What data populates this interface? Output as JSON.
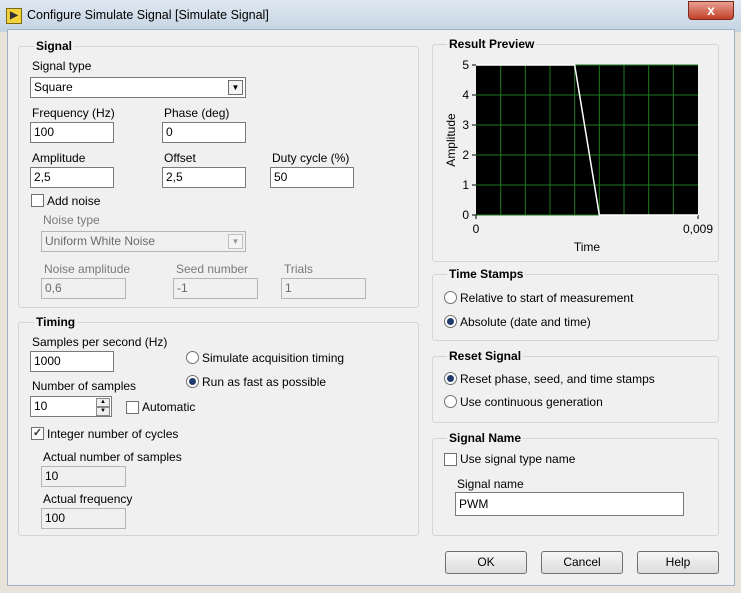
{
  "window": {
    "title": "Configure Simulate Signal [Simulate Signal]",
    "icon_name": "labview-vi-icon",
    "close_glyph": "x"
  },
  "signal": {
    "group_title": "Signal",
    "signal_type_label": "Signal type",
    "signal_type_value": "Square",
    "frequency_label": "Frequency (Hz)",
    "frequency_value": "100",
    "phase_label": "Phase (deg)",
    "phase_value": "0",
    "amplitude_label": "Amplitude",
    "amplitude_value": "2,5",
    "offset_label": "Offset",
    "offset_value": "2,5",
    "duty_label": "Duty cycle (%)",
    "duty_value": "50",
    "add_noise_label": "Add noise",
    "add_noise_checked": false,
    "noise_type_label": "Noise type",
    "noise_type_value": "Uniform White Noise",
    "noise_amp_label": "Noise amplitude",
    "noise_amp_value": "0,6",
    "seed_label": "Seed number",
    "seed_value": "-1",
    "trials_label": "Trials",
    "trials_value": "1"
  },
  "timing": {
    "group_title": "Timing",
    "sps_label": "Samples per second (Hz)",
    "sps_value": "1000",
    "simulate_label": "Simulate acquisition timing",
    "run_fast_label": "Run as fast as possible",
    "nsamples_label": "Number of samples",
    "nsamples_value": "10",
    "automatic_label": "Automatic",
    "integer_label": "Integer number of cycles",
    "integer_checked": true,
    "actual_nsamples_label": "Actual number of samples",
    "actual_nsamples_value": "10",
    "actual_freq_label": "Actual frequency",
    "actual_freq_value": "100"
  },
  "preview": {
    "group_title": "Result Preview",
    "ylabel": "Amplitude",
    "xlabel": "Time"
  },
  "chart_data": {
    "type": "line",
    "title": "Result Preview",
    "xlabel": "Time",
    "ylabel": "Amplitude",
    "x_ticks": [
      "0",
      "0,009"
    ],
    "y_ticks": [
      "0",
      "1",
      "2",
      "3",
      "4",
      "5"
    ],
    "xlim": [
      0,
      0.009
    ],
    "ylim": [
      0,
      5
    ],
    "grid": true,
    "background_color": "#000000",
    "grid_color": "#1f7a1f",
    "series": [
      {
        "color": "#ffffff",
        "x": [
          0,
          0.004,
          0.005,
          0.009
        ],
        "y": [
          5,
          5,
          0,
          0
        ]
      }
    ]
  },
  "timestamps": {
    "group_title": "Time Stamps",
    "relative_label": "Relative to start of measurement",
    "absolute_label": "Absolute (date and time)"
  },
  "reset": {
    "group_title": "Reset Signal",
    "reset_label": "Reset phase, seed, and time stamps",
    "continuous_label": "Use continuous generation"
  },
  "signal_name": {
    "group_title": "Signal Name",
    "use_type_label": "Use signal type name",
    "name_label": "Signal name",
    "name_value": "PWM"
  },
  "buttons": {
    "ok": "OK",
    "cancel": "Cancel",
    "help": "Help"
  }
}
